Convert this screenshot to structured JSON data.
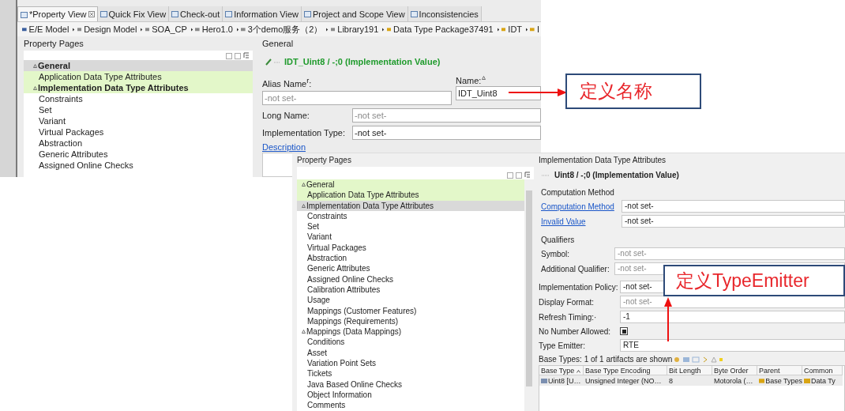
{
  "top": {
    "tabs": [
      {
        "label": "*Property View",
        "selected": true
      },
      {
        "label": "Quick Fix View",
        "selected": false
      },
      {
        "label": "Check-out",
        "selected": false
      },
      {
        "label": "Information View",
        "selected": false
      },
      {
        "label": "Project and Scope View",
        "selected": false
      },
      {
        "label": "Inconsistencies",
        "selected": false
      }
    ],
    "breadcrumb": [
      "E/E Model",
      "Design Model",
      "SOA_CP",
      "Hero1.0",
      "3个demo服务（2）",
      "Library191",
      "Data Type Package37491",
      "IDT",
      "I"
    ],
    "property_pages": {
      "title": "Property Pages",
      "items": [
        {
          "label": "General",
          "selected": true,
          "highlighted": false,
          "bold": true,
          "marker": true
        },
        {
          "label": "Application Data Type Attributes",
          "selected": false,
          "highlighted": true,
          "bold": false,
          "marker": false
        },
        {
          "label": "Implementation Data Type Attributes",
          "selected": false,
          "highlighted": true,
          "bold": true,
          "marker": true
        },
        {
          "label": "Constraints",
          "selected": false,
          "highlighted": false,
          "bold": false,
          "marker": false
        },
        {
          "label": "Set",
          "selected": false,
          "highlighted": false,
          "bold": false,
          "marker": false
        },
        {
          "label": "Variant",
          "selected": false,
          "highlighted": false,
          "bold": false,
          "marker": false
        },
        {
          "label": "Virtual Packages",
          "selected": false,
          "highlighted": false,
          "bold": false,
          "marker": false
        },
        {
          "label": "Abstraction",
          "selected": false,
          "highlighted": false,
          "bold": false,
          "marker": false
        },
        {
          "label": "Generic Attributes",
          "selected": false,
          "highlighted": false,
          "bold": false,
          "marker": false
        },
        {
          "label": "Assigned Online Checks",
          "selected": false,
          "highlighted": false,
          "bold": false,
          "marker": false
        }
      ]
    },
    "general": {
      "title": "General",
      "header": "IDT_Uint8 / -;0 (Implementation Value)",
      "alias_label": "Alias Name$^{r}$:",
      "alias_value": "-not set-",
      "name_label": "Name:",
      "name_value": "IDT_Uint8",
      "fields": [
        {
          "label": "Long Name:",
          "value": "-not set-",
          "greyed": true
        },
        {
          "label": "Implementation Type:",
          "value": "-not set-",
          "greyed": false
        }
      ],
      "description_link": "Description"
    }
  },
  "bottom": {
    "property_pages": {
      "title": "Property Pages",
      "items": [
        {
          "label": "General",
          "selected": false,
          "highlighted": true,
          "bold": false,
          "marker": true
        },
        {
          "label": "Application Data Type Attributes",
          "selected": false,
          "highlighted": true,
          "bold": false,
          "marker": false
        },
        {
          "label": "Implementation Data Type Attributes",
          "selected": true,
          "highlighted": false,
          "bold": false,
          "marker": true
        },
        {
          "label": "Constraints",
          "selected": false,
          "highlighted": false,
          "bold": false,
          "marker": false
        },
        {
          "label": "Set",
          "selected": false,
          "highlighted": false,
          "bold": false,
          "marker": false
        },
        {
          "label": "Variant",
          "selected": false,
          "highlighted": false,
          "bold": false,
          "marker": false
        },
        {
          "label": "Virtual Packages",
          "selected": false,
          "highlighted": false,
          "bold": false,
          "marker": false
        },
        {
          "label": "Abstraction",
          "selected": false,
          "highlighted": false,
          "bold": false,
          "marker": false
        },
        {
          "label": "Generic Attributes",
          "selected": false,
          "highlighted": false,
          "bold": false,
          "marker": false
        },
        {
          "label": "Assigned Online Checks",
          "selected": false,
          "highlighted": false,
          "bold": false,
          "marker": false
        },
        {
          "label": "Calibration Attributes",
          "selected": false,
          "highlighted": false,
          "bold": false,
          "marker": false
        },
        {
          "label": "Usage",
          "selected": false,
          "highlighted": false,
          "bold": false,
          "marker": false
        },
        {
          "label": "Mappings (Customer Features)",
          "selected": false,
          "highlighted": false,
          "bold": false,
          "marker": false
        },
        {
          "label": "Mappings (Requirements)",
          "selected": false,
          "highlighted": false,
          "bold": false,
          "marker": false
        },
        {
          "label": "Mappings (Data Mappings)",
          "selected": false,
          "highlighted": false,
          "bold": false,
          "marker": true
        },
        {
          "label": "Conditions",
          "selected": false,
          "highlighted": false,
          "bold": false,
          "marker": false
        },
        {
          "label": "Asset",
          "selected": false,
          "highlighted": false,
          "bold": false,
          "marker": false
        },
        {
          "label": "Variation Point Sets",
          "selected": false,
          "highlighted": false,
          "bold": false,
          "marker": false
        },
        {
          "label": "Tickets",
          "selected": false,
          "highlighted": false,
          "bold": false,
          "marker": false
        },
        {
          "label": "Java Based Online Checks",
          "selected": false,
          "highlighted": false,
          "bold": false,
          "marker": false
        },
        {
          "label": "Object Information",
          "selected": false,
          "highlighted": false,
          "bold": false,
          "marker": false
        },
        {
          "label": "Comments",
          "selected": false,
          "highlighted": false,
          "bold": false,
          "marker": false
        }
      ]
    },
    "attributes": {
      "title": "Implementation Data Type Attributes",
      "header": "Uint8 / -;0 (Implementation Value)",
      "sections": [
        {
          "title": "Computation Method",
          "rows": [
            {
              "kind": "link",
              "label": "Computation Method",
              "value": "-not set-",
              "greyed": false
            },
            {
              "kind": "link",
              "label": "Invalid Value",
              "value": "-not set-",
              "greyed": false
            }
          ]
        },
        {
          "title": "Qualifiers",
          "rows": [
            {
              "kind": "text",
              "label": "Symbol:",
              "value": "-not set-",
              "greyed": true
            },
            {
              "kind": "text",
              "label": "Additional Qualifier:",
              "value": "-not set-",
              "greyed": true
            }
          ]
        }
      ],
      "rows": [
        {
          "kind": "text",
          "label": "Implementation Policy:",
          "value": "-not set-",
          "greyed": false
        },
        {
          "kind": "text",
          "label": "Display Format:",
          "value": "-not set-",
          "greyed": true
        },
        {
          "kind": "text",
          "label": "Refresh Timing:·",
          "value": "-1",
          "greyed": false
        },
        {
          "kind": "checkbox",
          "label": "No Number Allowed:",
          "checked": true
        },
        {
          "kind": "text",
          "label": "Type Emitter:",
          "value": "RTE",
          "greyed": false
        }
      ],
      "base_types": {
        "caption": "Base Types: 1 of 1 artifacts are shown",
        "columns": [
          {
            "label": "Base Type",
            "sorted": true
          },
          {
            "label": "Base Type Encoding",
            "sorted": false
          },
          {
            "label": "Bit Length",
            "sorted": false
          },
          {
            "label": "Byte Order",
            "sorted": false
          },
          {
            "label": "Parent",
            "sorted": false
          },
          {
            "label": "Common",
            "sorted": false
          }
        ],
        "rows": [
          [
            {
              "text": "Uint8 [U…",
              "icon": true
            },
            {
              "text": "Unsigned Integer (NO…",
              "icon": false
            },
            {
              "text": "8",
              "icon": false
            },
            {
              "text": "Motorola (…",
              "icon": false
            },
            {
              "text": "Base Types",
              "icon": true
            },
            {
              "text": "Data Ty",
              "icon": true
            }
          ]
        ]
      }
    }
  },
  "annotations": [
    {
      "text": "定义名称"
    },
    {
      "text": "定义TypeEmitter"
    }
  ]
}
